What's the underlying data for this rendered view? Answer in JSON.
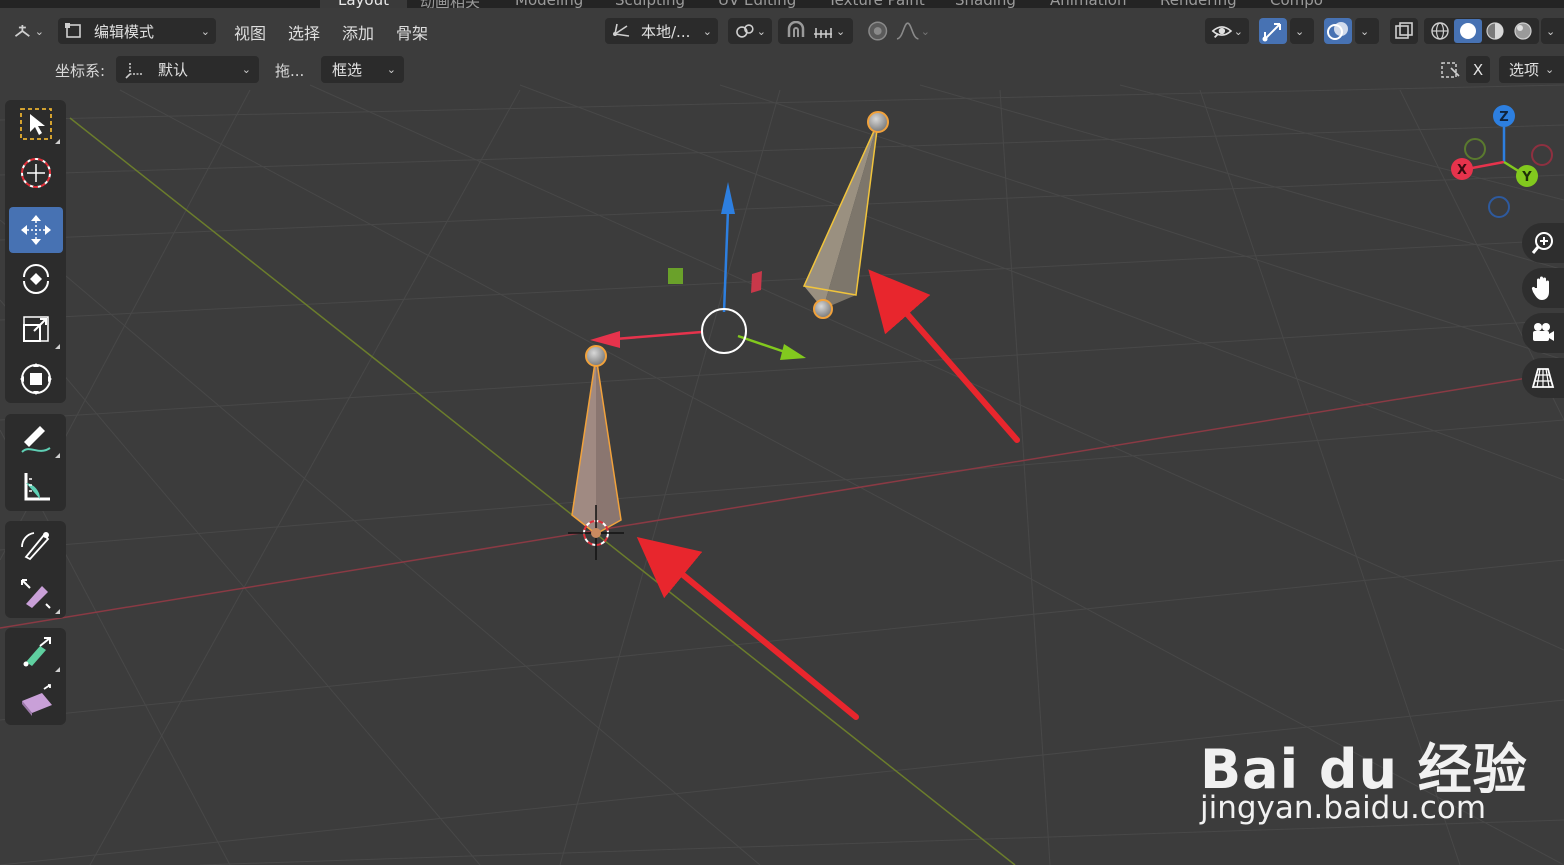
{
  "workspace_tabs": [
    "Layout",
    "动画相关",
    "Modeling",
    "Sculpting",
    "UV Editing",
    "Texture Paint",
    "Shading",
    "Animation",
    "Rendering",
    "Compo"
  ],
  "header": {
    "mode_label": "编辑模式",
    "menus": [
      "视图",
      "选择",
      "添加",
      "骨架"
    ],
    "transform_orientation_label": "本地/...",
    "options_label": "选项"
  },
  "tool_settings": {
    "coord_label": "坐标系:",
    "coord_value": "默认",
    "drag_label": "拖...",
    "drag_value": "框选",
    "close_glyph": "X"
  },
  "gizmo_axes": {
    "x": "X",
    "y": "Y",
    "z": "Z"
  },
  "watermark": {
    "logo_text": "Bai du 经验",
    "url": "jingyan.baidu.com"
  },
  "colors": {
    "active_blue": "#4772b3",
    "bone_selected": "#f1a23c",
    "axis_x": "#e6334c",
    "axis_y": "#82c91e",
    "axis_z": "#2d7fe0",
    "annotation_arrow": "#e8262d"
  }
}
